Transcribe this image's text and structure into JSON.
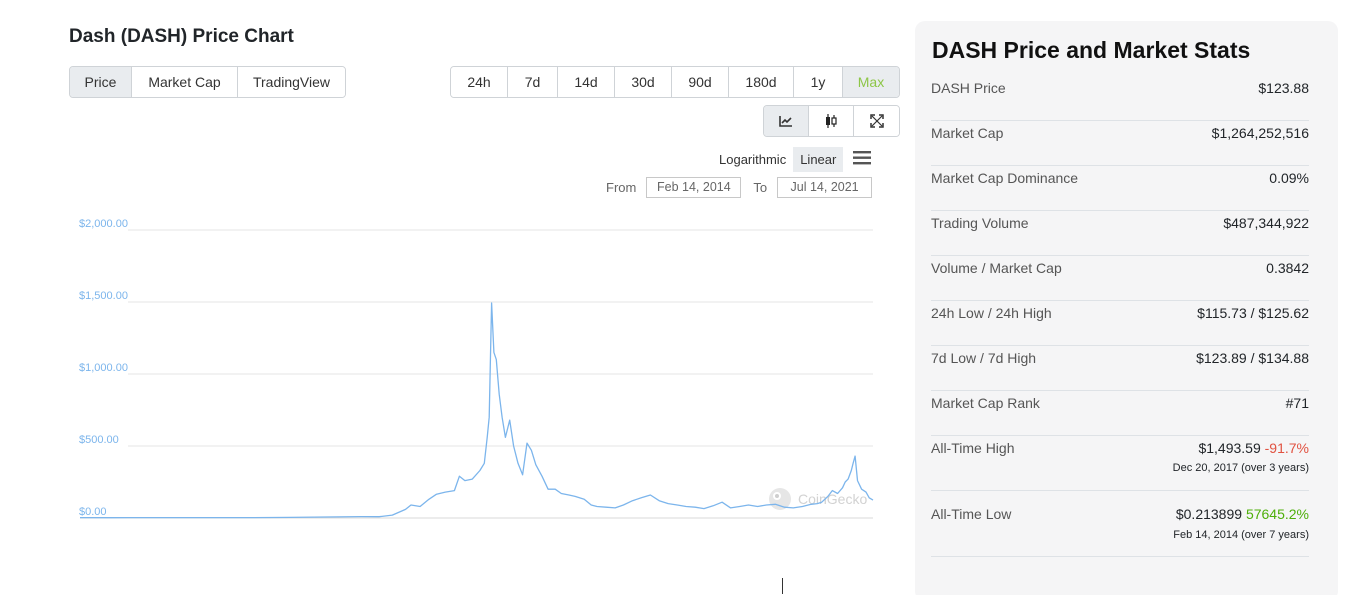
{
  "chart_title": "Dash (DASH) Price Chart",
  "metric_tabs": [
    {
      "label": "Price",
      "active": true
    },
    {
      "label": "Market Cap",
      "active": false
    },
    {
      "label": "TradingView",
      "active": false
    }
  ],
  "range_tabs": [
    {
      "label": "24h"
    },
    {
      "label": "7d"
    },
    {
      "label": "14d"
    },
    {
      "label": "30d"
    },
    {
      "label": "90d"
    },
    {
      "label": "180d"
    },
    {
      "label": "1y"
    },
    {
      "label": "Max",
      "active": true
    }
  ],
  "chart_type_buttons": [
    {
      "icon": "line-chart-icon",
      "active": true
    },
    {
      "icon": "candlestick-icon",
      "active": false
    },
    {
      "icon": "fullscreen-icon",
      "active": false
    }
  ],
  "scale": {
    "log_label": "Logarithmic",
    "linear_label": "Linear",
    "active": "Linear"
  },
  "date_range": {
    "from_label": "From",
    "from_value": "Feb 14, 2014",
    "to_label": "To",
    "to_value": "Jul 14, 2021"
  },
  "watermark": "CoinGecko",
  "colors": {
    "line": "#7cb5ec",
    "accent_green": "#8dc647",
    "negative": "#e15241",
    "positive": "#4eaf0a"
  },
  "chart_data": {
    "type": "line",
    "title": "",
    "xlabel": "",
    "ylabel": "",
    "ylim": [
      0,
      2000
    ],
    "xlim": [
      "2014-02-14",
      "2021-07-14"
    ],
    "yticks": [
      "$0.00",
      "$500.00",
      "$1,000.00",
      "$1,500.00",
      "$2,000.00"
    ],
    "ytick_values": [
      0,
      500,
      1000,
      1500,
      2000
    ],
    "grid": true,
    "series": [
      {
        "x": [
          "2014-02-14",
          "2014-06-01",
          "2014-10-01",
          "2015-02-01",
          "2015-06-01",
          "2015-10-01",
          "2016-02-01",
          "2016-06-01",
          "2016-10-01",
          "2016-12-01",
          "2017-01-15",
          "2017-03-01",
          "2017-03-20",
          "2017-04-20",
          "2017-05-20",
          "2017-06-15",
          "2017-07-15",
          "2017-08-15",
          "2017-09-01",
          "2017-09-20",
          "2017-10-15",
          "2017-11-10",
          "2017-11-25",
          "2017-12-05",
          "2017-12-12",
          "2017-12-20",
          "2017-12-28",
          "2018-01-05",
          "2018-01-15",
          "2018-01-25",
          "2018-02-05",
          "2018-02-20",
          "2018-03-05",
          "2018-03-20",
          "2018-04-05",
          "2018-04-20",
          "2018-05-05",
          "2018-05-20",
          "2018-06-10",
          "2018-07-01",
          "2018-07-25",
          "2018-08-15",
          "2018-09-10",
          "2018-10-01",
          "2018-11-01",
          "2018-11-25",
          "2018-12-15",
          "2019-01-15",
          "2019-02-15",
          "2019-03-15",
          "2019-04-15",
          "2019-05-15",
          "2019-06-15",
          "2019-07-15",
          "2019-08-15",
          "2019-09-15",
          "2019-10-15",
          "2019-11-15",
          "2019-12-15",
          "2020-01-15",
          "2020-02-15",
          "2020-03-15",
          "2020-04-15",
          "2020-05-15",
          "2020-06-15",
          "2020-07-15",
          "2020-08-15",
          "2020-09-15",
          "2020-10-15",
          "2020-11-15",
          "2020-12-15",
          "2021-01-05",
          "2021-01-20",
          "2021-02-10",
          "2021-02-25",
          "2021-03-15",
          "2021-04-01",
          "2021-04-10",
          "2021-04-20",
          "2021-05-01",
          "2021-05-07",
          "2021-05-14",
          "2021-05-22",
          "2021-06-05",
          "2021-06-20",
          "2021-07-01",
          "2021-07-14"
        ],
        "values": [
          3,
          2,
          3,
          3,
          3,
          3,
          4,
          7,
          10,
          9,
          20,
          60,
          90,
          80,
          130,
          165,
          180,
          190,
          290,
          260,
          270,
          330,
          380,
          560,
          700,
          1493,
          1150,
          1100,
          860,
          700,
          560,
          680,
          500,
          380,
          300,
          520,
          470,
          370,
          290,
          200,
          200,
          170,
          160,
          150,
          130,
          90,
          80,
          75,
          70,
          90,
          120,
          140,
          160,
          120,
          100,
          90,
          80,
          75,
          65,
          85,
          110,
          70,
          80,
          90,
          80,
          90,
          95,
          75,
          70,
          80,
          95,
          100,
          110,
          150,
          190,
          170,
          210,
          250,
          270,
          330,
          380,
          430,
          260,
          200,
          180,
          140,
          124
        ]
      }
    ]
  },
  "stats": {
    "title": "DASH Price and Market Stats",
    "rows": [
      {
        "label": "DASH Price",
        "value": "$123.88"
      },
      {
        "label": "Market Cap",
        "value": "$1,264,252,516"
      },
      {
        "label": "Market Cap Dominance",
        "value": "0.09%"
      },
      {
        "label": "Trading Volume",
        "value": "$487,344,922"
      },
      {
        "label": "Volume / Market Cap",
        "value": "0.3842"
      },
      {
        "label": "24h Low / 24h High",
        "value": "$115.73 / $125.62"
      },
      {
        "label": "7d Low / 7d High",
        "value": "$123.89 / $134.88"
      },
      {
        "label": "Market Cap Rank",
        "value": "#71"
      }
    ],
    "ath": {
      "label": "All-Time High",
      "value": "$1,493.59",
      "change": "-91.7%",
      "date": "Dec 20, 2017 (over 3 years)"
    },
    "atl": {
      "label": "All-Time Low",
      "value": "$0.213899",
      "change": "57645.2%",
      "date": "Feb 14, 2014 (over 7 years)"
    }
  }
}
